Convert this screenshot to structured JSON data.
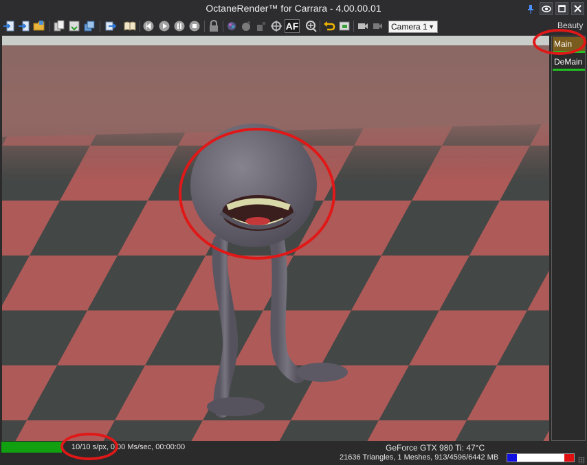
{
  "window": {
    "title": "OctaneRender™ for Carrara - 4.00.00.01"
  },
  "toolbar": {
    "icons": [
      "export-icon",
      "export-all-icon",
      "folder-icon",
      "copy-icon",
      "save-icon",
      "stack-icon",
      "send-icon",
      "book-icon",
      "rewind-icon",
      "play-icon",
      "pause-icon",
      "stop-icon",
      "lock-icon",
      "color-sphere-icon",
      "material-icon",
      "object-icon",
      "focus-icon",
      "autofocus-icon",
      "zoom-icon",
      "undo-icon",
      "region-icon",
      "camera-icon",
      "camera-edit-icon"
    ],
    "autofocus_label": "AF",
    "camera_selected": "Camera 1"
  },
  "passes": {
    "header": "Beauty",
    "items": [
      {
        "label": "Main"
      },
      {
        "label": "DeMain"
      }
    ]
  },
  "status": {
    "samples": "10/10 s/px, 0.00 Ms/sec, 00:00:00",
    "gpu": "GeForce GTX 980 Ti: 47°C",
    "mesh_info": "21636 Triangles, 1 Meshes, 913/4596/6442 MB",
    "render_progress": 1.0
  },
  "colors": {
    "accent_red": "#e01818",
    "progress_green": "#10a010",
    "pass_active": "#7a5c1e",
    "floor_red": "#b05a58",
    "floor_dark": "#3f4644",
    "character": "#6f6c78"
  }
}
